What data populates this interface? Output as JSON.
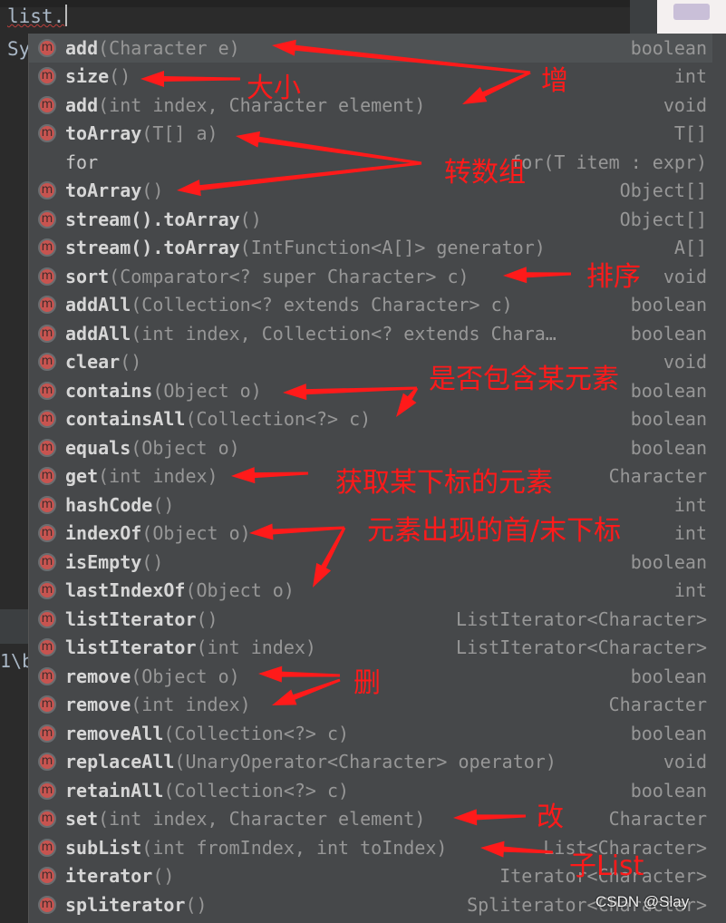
{
  "editor": {
    "typed": "list.",
    "next_line_prefix": "Sy",
    "path_fragment": "1\\b"
  },
  "popup": {
    "items": [
      {
        "name": "add",
        "sig": "(Character e)",
        "type": "boolean",
        "icon": "method-icon"
      },
      {
        "name": "size",
        "sig": "()",
        "type": "int",
        "icon": "method-icon"
      },
      {
        "name": "add",
        "sig": "(int index, Character element)",
        "type": "void",
        "icon": "method-icon"
      },
      {
        "name": "toArray",
        "sig": "(T[] a)",
        "type": "T[]",
        "icon": "method-icon"
      },
      {
        "name": "for",
        "sig": "",
        "type": "for(T item : expr)",
        "icon": ""
      },
      {
        "name": "toArray",
        "sig": "()",
        "type": "Object[]",
        "icon": "method-icon"
      },
      {
        "name": "stream().toArray",
        "sig": "()",
        "type": "Object[]",
        "icon": "method-icon"
      },
      {
        "name": "stream().toArray",
        "sig": "(IntFunction<A[]> generator)",
        "type": "A[]",
        "icon": "method-icon"
      },
      {
        "name": "sort",
        "sig": "(Comparator<? super Character> c)",
        "type": "void",
        "icon": "method-icon"
      },
      {
        "name": "addAll",
        "sig": "(Collection<? extends Character> c)",
        "type": "boolean",
        "icon": "method-icon"
      },
      {
        "name": "addAll",
        "sig": "(int index, Collection<? extends Chara…",
        "type": "boolean",
        "icon": "method-icon"
      },
      {
        "name": "clear",
        "sig": "()",
        "type": "void",
        "icon": "method-icon"
      },
      {
        "name": "contains",
        "sig": "(Object o)",
        "type": "boolean",
        "icon": "method-icon"
      },
      {
        "name": "containsAll",
        "sig": "(Collection<?> c)",
        "type": "boolean",
        "icon": "method-icon"
      },
      {
        "name": "equals",
        "sig": "(Object o)",
        "type": "boolean",
        "icon": "method-icon"
      },
      {
        "name": "get",
        "sig": "(int index)",
        "type": "Character",
        "icon": "method-icon"
      },
      {
        "name": "hashCode",
        "sig": "()",
        "type": "int",
        "icon": "method-icon"
      },
      {
        "name": "indexOf",
        "sig": "(Object o)",
        "type": "int",
        "icon": "method-icon"
      },
      {
        "name": "isEmpty",
        "sig": "()",
        "type": "boolean",
        "icon": "method-icon"
      },
      {
        "name": "lastIndexOf",
        "sig": "(Object o)",
        "type": "int",
        "icon": "method-icon"
      },
      {
        "name": "listIterator",
        "sig": "()",
        "type": "ListIterator<Character>",
        "icon": "method-icon"
      },
      {
        "name": "listIterator",
        "sig": "(int index)",
        "type": "ListIterator<Character>",
        "icon": "method-icon"
      },
      {
        "name": "remove",
        "sig": "(Object o)",
        "type": "boolean",
        "icon": "method-icon"
      },
      {
        "name": "remove",
        "sig": "(int index)",
        "type": "Character",
        "icon": "method-icon"
      },
      {
        "name": "removeAll",
        "sig": "(Collection<?> c)",
        "type": "boolean",
        "icon": "method-icon"
      },
      {
        "name": "replaceAll",
        "sig": "(UnaryOperator<Character> operator)",
        "type": "void",
        "icon": "method-icon"
      },
      {
        "name": "retainAll",
        "sig": "(Collection<?> c)",
        "type": "boolean",
        "icon": "method-icon"
      },
      {
        "name": "set",
        "sig": "(int index, Character element)",
        "type": "Character",
        "icon": "method-icon"
      },
      {
        "name": "subList",
        "sig": "(int fromIndex, int toIndex)",
        "type": "List<Character>",
        "icon": "method-icon"
      },
      {
        "name": "iterator",
        "sig": "()",
        "type": "Iterator<Character>",
        "icon": "method-icon"
      },
      {
        "name": "spliterator",
        "sig": "()",
        "type": "Spliterator<Character>",
        "icon": "method-icon"
      }
    ],
    "icon_letter": "m",
    "selected_index": 0
  },
  "annotations": [
    {
      "text": "增"
    },
    {
      "text": "大小"
    },
    {
      "text": "转数组"
    },
    {
      "text": "排序"
    },
    {
      "text": "是否包含某元素"
    },
    {
      "text": "获取某下标的元素"
    },
    {
      "text": "元素出现的首/末下标"
    },
    {
      "text": "删"
    },
    {
      "text": "改"
    },
    {
      "text": "子List"
    }
  ],
  "annotation_color": "#ff1a1a",
  "watermark": "CSDN @Slay"
}
